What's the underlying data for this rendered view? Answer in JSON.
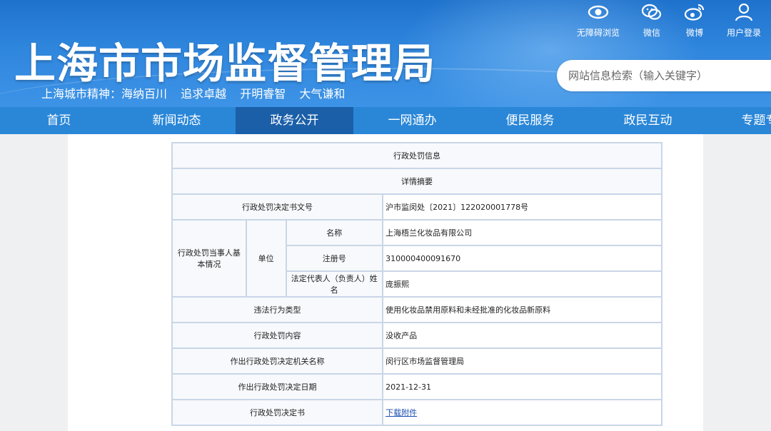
{
  "header": {
    "title": "上海市市场监督管理局",
    "slogan": [
      "上海城市精神：海纳百川",
      "追求卓越",
      "开明睿智",
      "大气谦和"
    ],
    "top_icons": [
      {
        "icon": "eye-icon",
        "label": "无障碍浏览"
      },
      {
        "icon": "wechat-icon",
        "label": "微信"
      },
      {
        "icon": "weibo-icon",
        "label": "微博"
      },
      {
        "icon": "user-icon",
        "label": "用户登录"
      }
    ],
    "search_placeholder": "网站信息检索（输入关键字）"
  },
  "nav": {
    "items": [
      "首页",
      "新闻动态",
      "政务公开",
      "一网通办",
      "便民服务",
      "政民互动",
      "专题专栏"
    ],
    "active": "政务公开"
  },
  "record": {
    "title": "行政处罚信息",
    "subtitle": "详情摘要",
    "doc_number_label": "行政处罚决定书文号",
    "doc_number": "沪市监闵处〔2021〕122020001778号",
    "party_label": "行政处罚当事人基本情况",
    "unit_label": "单位",
    "name_label": "名称",
    "name_value": "上海梧兰化妆品有限公司",
    "reg_label": "注册号",
    "reg_value": "310000400091670",
    "rep_label": "法定代表人（负责人）姓名",
    "rep_value": "庞振熙",
    "violation_label": "违法行为类型",
    "violation_value": "使用化妆品禁用原料和未经批准的化妆品新原料",
    "penalty_label": "行政处罚内容",
    "penalty_value": "没收产品",
    "authority_label": "作出行政处罚决定机关名称",
    "authority_value": "闵行区市场监督管理局",
    "date_label": "作出行政处罚决定日期",
    "date_value": "2021-12-31",
    "decision_label": "行政处罚决定书",
    "decision_link": "下载附件"
  },
  "colors": {
    "header_blue": "#2f86dd",
    "nav_blue": "#2a87d8",
    "nav_active": "#1b5fa8",
    "table_border": "#c9d6e6",
    "link": "#1a4db3"
  }
}
